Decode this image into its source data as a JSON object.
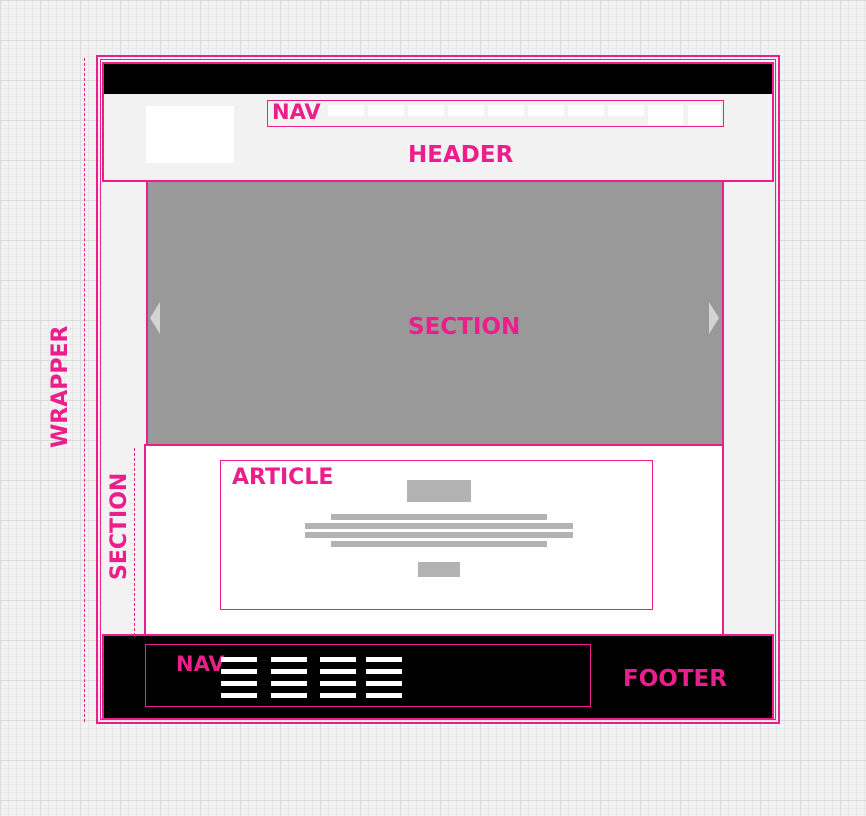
{
  "colors": {
    "accent": "#ec1e8c",
    "header_bar": "#000000",
    "slider": "#999999",
    "footer": "#000000"
  },
  "wrapper": {
    "label": "WRAPPER"
  },
  "header": {
    "label": "HEADER",
    "nav_label": "NAV"
  },
  "slider": {
    "label": "SECTION",
    "prev_icon": "arrow-left-icon",
    "next_icon": "arrow-right-icon"
  },
  "content_section": {
    "label": "SECTION"
  },
  "article": {
    "label": "ARTICLE"
  },
  "footer": {
    "label": "FOOTER",
    "nav_label": "NAV"
  }
}
